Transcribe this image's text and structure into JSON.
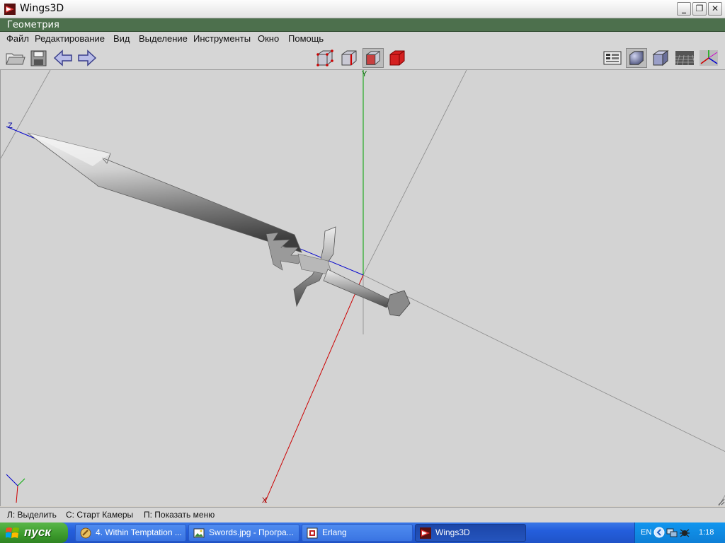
{
  "window": {
    "title": "Wings3D",
    "minimize": "_",
    "maximize": "❐",
    "close": "✕"
  },
  "geometry_bar": {
    "label": "Геометрия"
  },
  "menu": [
    "Файл",
    "Редактирование",
    "Вид",
    "Выделение",
    "Инструменты",
    "Окно",
    "Помощь"
  ],
  "toolbar": {
    "left": [
      "open-icon",
      "save-icon",
      "undo-arrow-icon",
      "redo-arrow-icon"
    ],
    "center": [
      "vertex-select-icon",
      "edge-select-icon",
      "face-select-icon",
      "body-select-icon"
    ],
    "right": [
      "outliner-icon",
      "smooth-shade-icon",
      "flat-shade-icon",
      "ground-grid-icon",
      "axes-icon"
    ]
  },
  "viewport": {
    "axis_labels": {
      "x": "X",
      "y": "Y",
      "z": "Z"
    },
    "colors": {
      "background": "#d3d3d3",
      "x_axis": "#cc0000",
      "y_axis": "#00a000",
      "z_axis": "#0000cc"
    }
  },
  "statusbar": {
    "items": [
      "Л: Выделить",
      "С: Старт Камеры",
      "П: Показать меню"
    ]
  },
  "taskbar": {
    "start_label": "пуск",
    "tasks": [
      {
        "label": "4. Within Temptation ...",
        "icon": "media-player-icon"
      },
      {
        "label": "Swords.jpg - Програ...",
        "icon": "image-viewer-icon"
      },
      {
        "label": "Erlang",
        "icon": "erlang-icon"
      },
      {
        "label": "Wings3D",
        "icon": "wings3d-icon"
      }
    ],
    "tray": {
      "lang": "EN",
      "time": "1:18"
    }
  }
}
